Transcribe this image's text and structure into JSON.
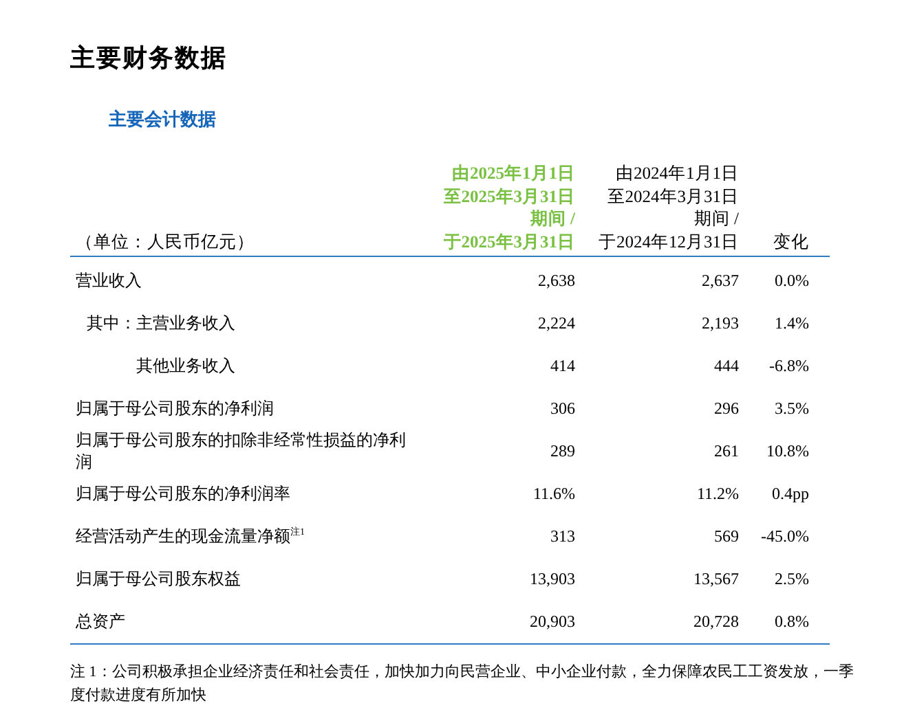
{
  "title": "主要财务数据",
  "subtitle": "主要会计数据",
  "table": {
    "columns": [
      {
        "lines": [
          "（单位：人民币亿元）"
        ],
        "current": false
      },
      {
        "lines": [
          "由2025年1月1日",
          "至2025年3月31日",
          "期间 /",
          "于2025年3月31日"
        ],
        "current": true
      },
      {
        "lines": [
          "由2024年1月1日",
          "至2024年3月31日",
          "期间 /",
          "于2024年12月31日"
        ],
        "current": false
      },
      {
        "lines": [
          "变化"
        ],
        "current": false
      }
    ],
    "rows": [
      {
        "label": "营业收入",
        "values": [
          "2,638",
          "2,637",
          "0.0%"
        ],
        "children": [
          {
            "prefix": "其中：",
            "label": "主营业务收入",
            "values": [
              "2,224",
              "2,193",
              "1.4%"
            ]
          },
          {
            "label": "其他业务收入",
            "values": [
              "414",
              "444",
              "-6.8%"
            ]
          }
        ]
      },
      {
        "label": "归属于母公司股东的净利润",
        "values": [
          "306",
          "296",
          "3.5%"
        ]
      },
      {
        "label": "归属于母公司股东的扣除非经常性损益的净利润",
        "values": [
          "289",
          "261",
          "10.8%"
        ]
      },
      {
        "label": "归属于母公司股东的净利润率",
        "values": [
          "11.6%",
          "11.2%",
          "0.4pp"
        ]
      },
      {
        "label": "经营活动产生的现金流量净额$^{注1}$",
        "values": [
          "313",
          "569",
          "-45.0%"
        ]
      },
      {
        "label": "归属于母公司股东权益",
        "values": [
          "13,903",
          "13,567",
          "2.5%"
        ]
      },
      {
        "label": "总资产",
        "values": [
          "20,903",
          "20,728",
          "0.8%"
        ]
      }
    ]
  },
  "footnote": "注 1：公司积极承担企业经济责任和社会责任，加快加力向民营企业、中小企业付款，全力保障农民工工资发放，一季度付款进度有所加快"
}
